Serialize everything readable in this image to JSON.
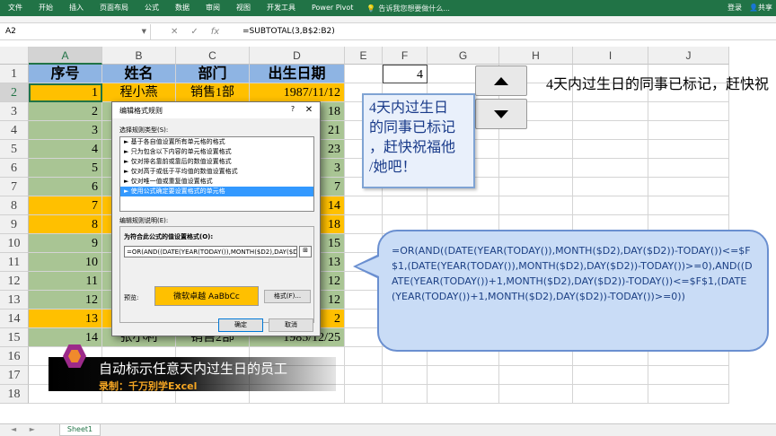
{
  "ribbon": {
    "tabs": [
      "文件",
      "开始",
      "插入",
      "页面布局",
      "公式",
      "数据",
      "审阅",
      "视图",
      "开发工具",
      "Power Pivot"
    ],
    "tell_me": "告诉我您想要做什么...",
    "login": "登录",
    "share": "共享"
  },
  "formula_bar": {
    "name_box": "A2",
    "cancel": "✕",
    "confirm": "✓",
    "fx": "fx",
    "formula": "=SUBTOTAL(3,B$2:B2)"
  },
  "columns": [
    "A",
    "B",
    "C",
    "D",
    "E",
    "F",
    "G",
    "H",
    "I",
    "J"
  ],
  "rows": [
    "1",
    "2",
    "3",
    "4",
    "5",
    "6",
    "7",
    "8",
    "9",
    "10",
    "11",
    "12",
    "13",
    "14",
    "15",
    "16",
    "17",
    "18"
  ],
  "table": {
    "headers": [
      "序号",
      "姓名",
      "部门",
      "出生日期"
    ],
    "row2": {
      "no": "1",
      "name": "程小燕",
      "dept": "销售1部",
      "date": "1987/11/12"
    },
    "row15": {
      "no": "14",
      "name": "张小利",
      "dept": "销售2部",
      "date": "1985/12/25"
    },
    "seq": [
      "1",
      "2",
      "3",
      "4",
      "5",
      "6",
      "7",
      "8",
      "9",
      "10",
      "11",
      "12",
      "13",
      "14"
    ],
    "d_partial": [
      "12",
      "18",
      "21",
      "23",
      "3",
      "7",
      "14",
      "18",
      "15",
      "13",
      "12",
      "12",
      "2",
      "25"
    ]
  },
  "f1_value": "4",
  "headline": "4天内过生日的同事已标记，赶快祝",
  "note": [
    "4天内过生日",
    "的同事已标记",
    "，赶快祝福他",
    "/她吧！"
  ],
  "callout_formula": "=OR(AND((DATE(YEAR(TODAY()),MONTH($D2),DAY($D2))-TODAY())<=$F$1,(DATE(YEAR(TODAY()),MONTH($D2),DAY($D2))-TODAY())>=0),AND((DATE(YEAR(TODAY())+1,MONTH($D2),DAY($D2))-TODAY())<=$F$1,(DATE(YEAR(TODAY())+1,MONTH($D2),DAY($D2))-TODAY())>=0))",
  "dialog": {
    "title": "编辑格式规则",
    "help": "?",
    "close": "✕",
    "type_label": "选择规则类型(S):",
    "rule_types": [
      "► 基于各自值设置所有单元格的格式",
      "► 只为包含以下内容的单元格设置格式",
      "► 仅对排名靠前或靠后的数值设置格式",
      "► 仅对高于或低于平均值的数值设置格式",
      "► 仅对唯一值或重复值设置格式",
      "► 使用公式确定要设置格式的单元格"
    ],
    "selected_index": 5,
    "desc_label": "编辑规则说明(E):",
    "formula_label": "为符合此公式的值设置格式(O):",
    "formula_value": "=OR(AND((DATE(YEAR(TODAY()),MONTH($D2),DAY($D2))-TODAY())<=$F$1,",
    "preview_label": "预览:",
    "preview_text": "微软卓越  AaBbCc",
    "format_button": "格式(F)...",
    "ok": "确定",
    "cancel": "取消"
  },
  "caption": {
    "title": "自动标示任意天内过生日的员工",
    "credit": "录制：千万别学Excel"
  },
  "sheet_tab": "Sheet1",
  "nav_arrows": "◄ ►",
  "colors": {
    "excel_green": "#217346",
    "header_blue": "#8eb4e3",
    "highlight_orange": "#ffc000",
    "green_fill": "#a9c594"
  }
}
